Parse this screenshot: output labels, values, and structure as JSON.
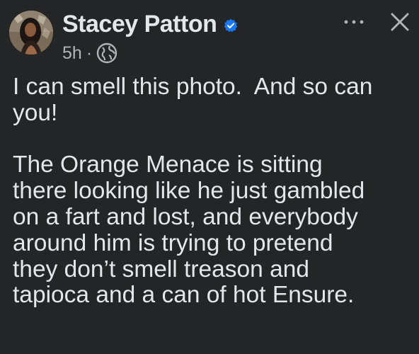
{
  "post": {
    "author": {
      "name": "Stacey Patton",
      "verified": true,
      "avatar_icon": "profile-photo"
    },
    "timestamp": "5h",
    "separator": "·",
    "audience_icon": "globe-icon",
    "menu_icon": "more-options-icon",
    "close_icon": "close-icon",
    "paragraphs": [
      {
        "lines": [
          "I can smell this photo.  And so can",
          "you!"
        ]
      },
      {
        "lines": [
          "The Orange Menace is sitting",
          "there looking like he just gambled",
          "on a fart and lost, and everybody",
          "around him is trying to pretend",
          "they don’t smell treason and",
          "tapioca and a can of hot Ensure."
        ]
      }
    ]
  },
  "colors": {
    "background": "#242526",
    "text_primary": "#e4e6eb",
    "text_secondary": "#b0b3b8",
    "verified_blue": "#1877f2"
  }
}
